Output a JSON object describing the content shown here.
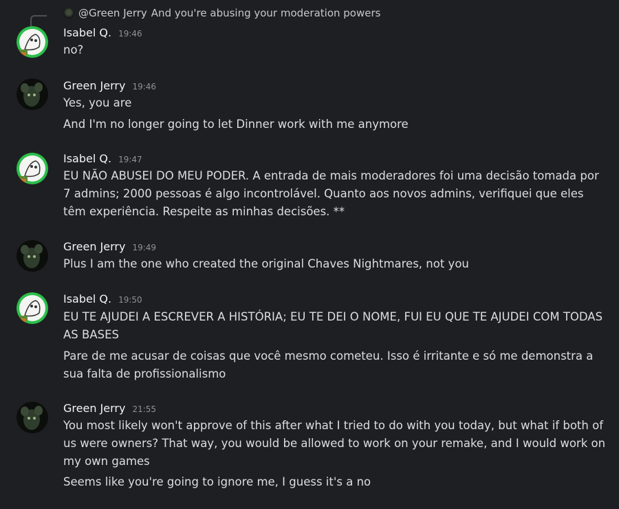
{
  "reply": {
    "author": "@Green Jerry",
    "text": "And you're abusing your moderation powers"
  },
  "messages": [
    {
      "author": "Isabel Q.",
      "time": "19:46",
      "lines": [
        "no?"
      ]
    },
    {
      "author": "Green Jerry",
      "time": "19:46",
      "lines": [
        "Yes, you are",
        "And I'm no longer going to let Dinner work with me anymore"
      ]
    },
    {
      "author": "Isabel Q.",
      "time": "19:47",
      "lines": [
        "EU NÃO ABUSEI DO MEU PODER. A entrada de mais moderadores foi uma decisão tomada por 7 admins; 2000 pessoas é algo incontrolável. Quanto aos novos admins, verifiquei que eles têm experiência. Respeite as minhas decisões. **"
      ]
    },
    {
      "author": "Green Jerry",
      "time": "19:49",
      "lines": [
        "Plus I am the one who created the original Chaves Nightmares, not you"
      ]
    },
    {
      "author": "Isabel Q.",
      "time": "19:50",
      "lines": [
        "EU TE AJUDEI A ESCREVER A HISTÓRIA; EU TE DEI O NOME, FUI EU QUE TE AJUDEI COM TODAS AS BASES",
        "Pare de me acusar de coisas que você mesmo cometeu. Isso é irritante e só me demonstra a sua falta de profissionalismo"
      ]
    },
    {
      "author": "Green Jerry",
      "time": "21:55",
      "lines": [
        "You most likely won't approve of this after what I tried to do with you today, but what if both of us were owners? That way, you would be allowed to work on your remake, and I would work on my own games",
        "Seems like you're going to ignore me, I guess it's a no"
      ]
    }
  ]
}
